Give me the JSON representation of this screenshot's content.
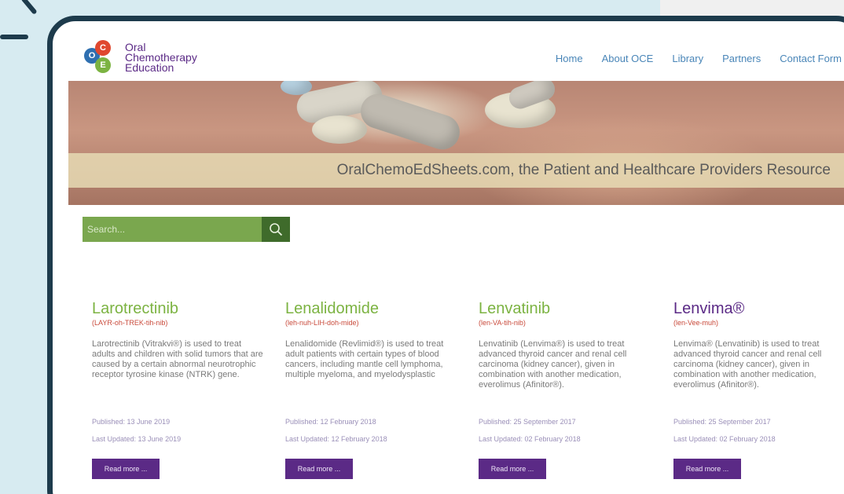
{
  "logo": {
    "letters": [
      "O",
      "C",
      "E"
    ],
    "lines": [
      "Oral",
      "Chemotherapy",
      "Education"
    ],
    "colors": [
      "#2f6fb0",
      "#e0482f",
      "#7cb342"
    ]
  },
  "nav": [
    "Home",
    "About OCE",
    "Library",
    "Partners",
    "Contact Form"
  ],
  "hero": {
    "tagline": "OralChemoEdSheets.com, the Patient and Healthcare Providers Resource"
  },
  "search": {
    "placeholder": "Search...",
    "icon": "search-icon"
  },
  "cards": [
    {
      "title": "Larotrectinib",
      "title_color": "#7cb342",
      "pronunciation": "(LAYR-oh-TREK-tih-nib)",
      "description": "Larotrectinib (Vitrakvi®) is used to treat adults and children with solid tumors that are caused by a certain abnormal neurotrophic receptor tyrosine kinase (NTRK) gene.",
      "published": "Published: 13 June 2019",
      "updated": "Last Updated: 13 June 2019",
      "button": "Read more ..."
    },
    {
      "title": "Lenalidomide",
      "title_color": "#7cb342",
      "pronunciation": "(leh-nuh-LIH-doh-mide)",
      "description": "Lenalidomide (Revlimid®) is used to treat adult patients with certain types of blood cancers, including mantle cell lymphoma, multiple myeloma, and myelodysplastic",
      "published": "Published: 12 February 2018",
      "updated": "Last Updated: 12 February 2018",
      "button": "Read more ..."
    },
    {
      "title": "Lenvatinib",
      "title_color": "#7cb342",
      "pronunciation": "(len-VA-tih-nib)",
      "description": "Lenvatinib (Lenvima®) is used to treat advanced thyroid cancer and renal cell carcinoma (kidney cancer), given in combination with another medication, everolimus (Afinitor®).",
      "published": "Published: 25 September 2017",
      "updated": "Last Updated: 02 February 2018",
      "button": "Read more ..."
    },
    {
      "title": "Lenvima®",
      "title_color": "#5b2a86",
      "pronunciation": "(len-Vee-muh)",
      "description": "Lenvima® (Lenvatinib) is used to treat advanced thyroid cancer and renal cell carcinoma (kidney cancer), given in combination with another medication, everolimus (Afinitor®).",
      "published": "Published: 25 September 2017",
      "updated": "Last Updated: 02 February 2018",
      "button": "Read more ..."
    }
  ]
}
